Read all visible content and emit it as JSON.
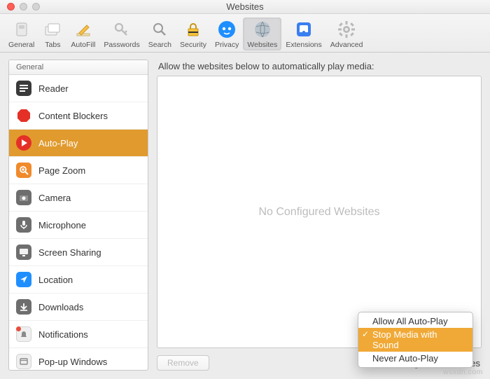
{
  "window": {
    "title": "Websites"
  },
  "toolbar": {
    "items": [
      {
        "label": "General"
      },
      {
        "label": "Tabs"
      },
      {
        "label": "AutoFill"
      },
      {
        "label": "Passwords"
      },
      {
        "label": "Search"
      },
      {
        "label": "Security"
      },
      {
        "label": "Privacy"
      },
      {
        "label": "Websites"
      },
      {
        "label": "Extensions"
      },
      {
        "label": "Advanced"
      }
    ]
  },
  "sidebar": {
    "header": "General",
    "items": [
      {
        "label": "Reader"
      },
      {
        "label": "Content Blockers"
      },
      {
        "label": "Auto-Play"
      },
      {
        "label": "Page Zoom"
      },
      {
        "label": "Camera"
      },
      {
        "label": "Microphone"
      },
      {
        "label": "Screen Sharing"
      },
      {
        "label": "Location"
      },
      {
        "label": "Downloads"
      },
      {
        "label": "Notifications"
      },
      {
        "label": "Pop-up Windows"
      }
    ]
  },
  "main": {
    "heading": "Allow the websites below to automatically play media:",
    "placeholder": "No Configured Websites",
    "remove_label": "Remove",
    "footer_label": "When visiting other websites"
  },
  "dropdown": {
    "options": [
      {
        "label": "Allow All Auto-Play"
      },
      {
        "label": "Stop Media with Sound"
      },
      {
        "label": "Never Auto-Play"
      }
    ]
  },
  "watermark": "wsxdn.com"
}
